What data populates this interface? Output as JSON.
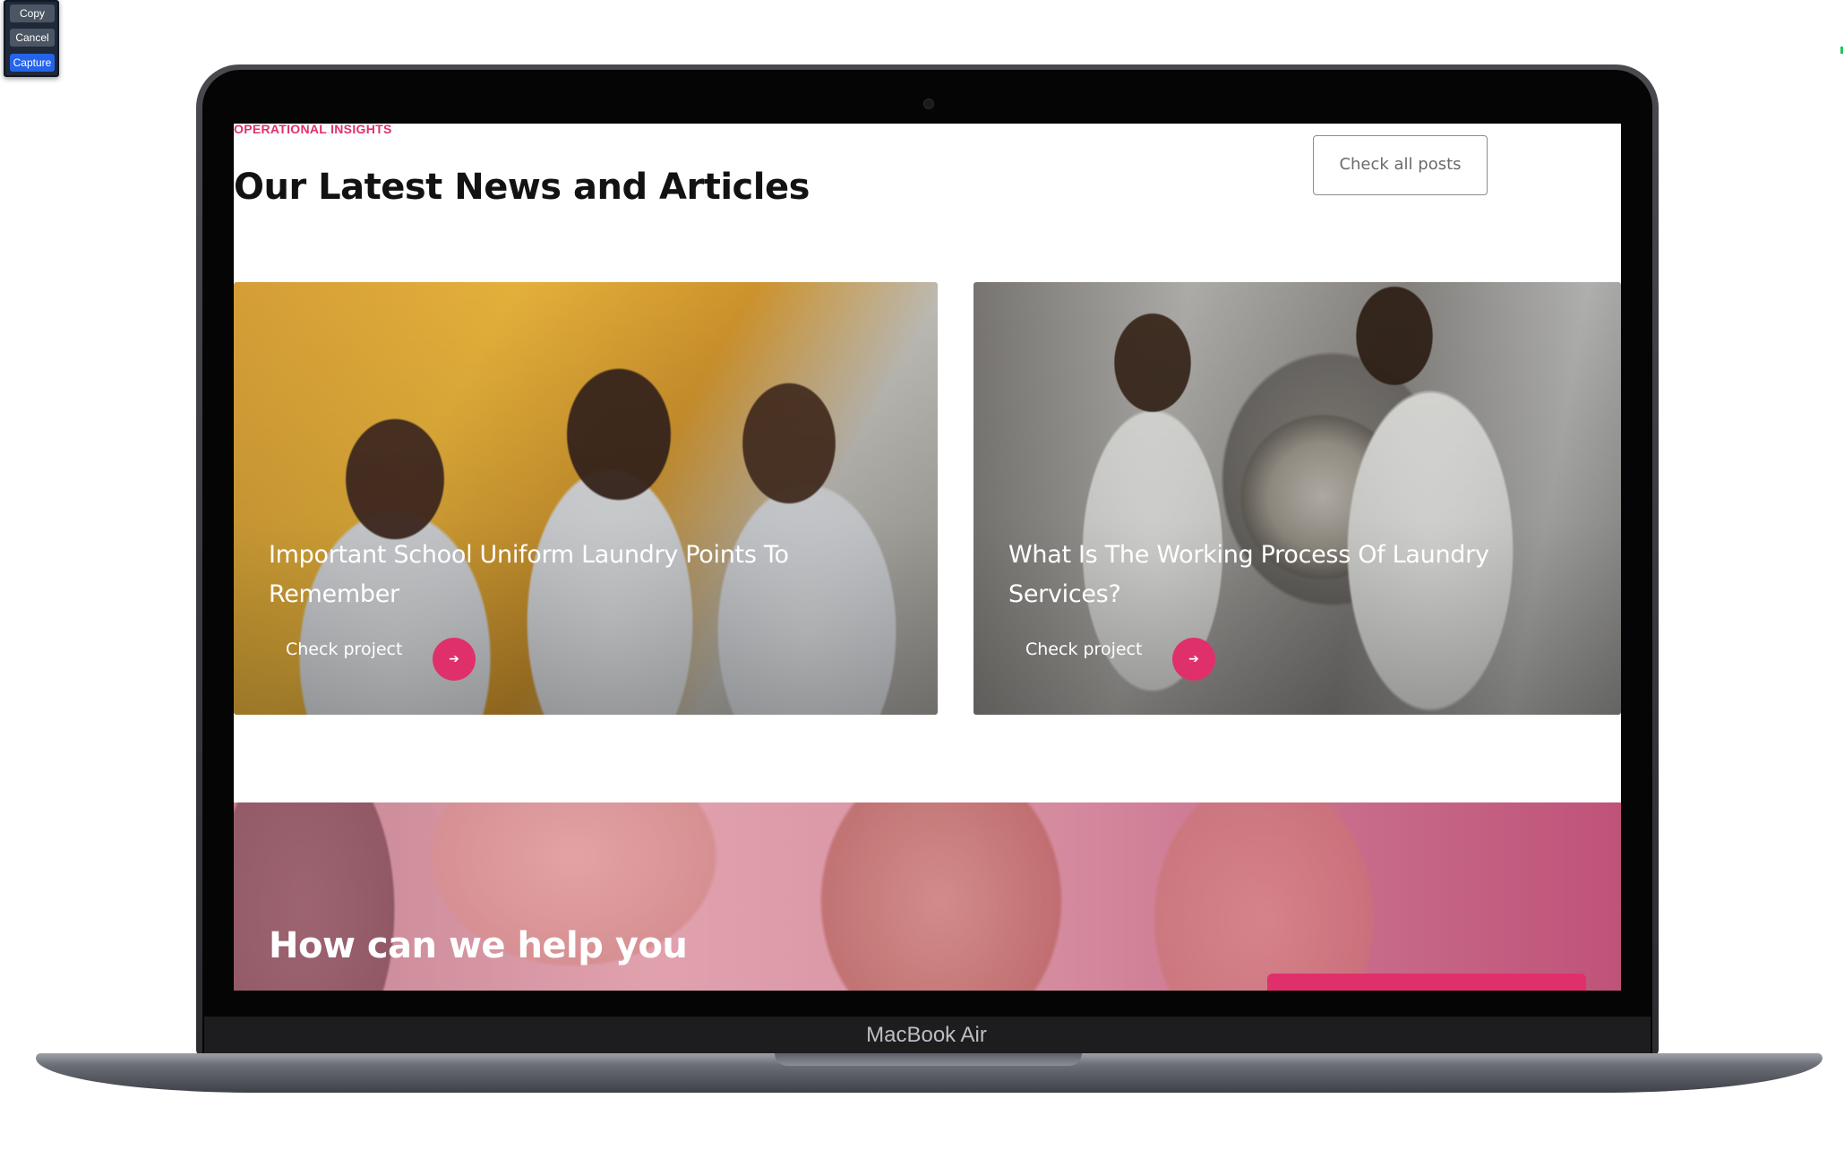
{
  "capture_toolbar": {
    "copy_label": "Copy",
    "cancel_label": "Cancel",
    "capture_label": "Capture"
  },
  "device": {
    "label": "MacBook Air"
  },
  "news_section": {
    "eyebrow": "OPERATIONAL INSIGHTS",
    "title": "Our Latest News and Articles",
    "check_all_label": "Check all posts",
    "cards": [
      {
        "title": "Important School Uniform Laundry Points To Remember",
        "link_label": "Check project",
        "arrow_glyph": "➔"
      },
      {
        "title": "What Is The Working Process Of Laundry Services?",
        "link_label": "Check project",
        "arrow_glyph": "➔"
      }
    ]
  },
  "help_banner": {
    "title": "How can we help you"
  },
  "colors": {
    "accent": "#e0306b",
    "heading": "#121212",
    "button_border": "#8c8c8c"
  }
}
